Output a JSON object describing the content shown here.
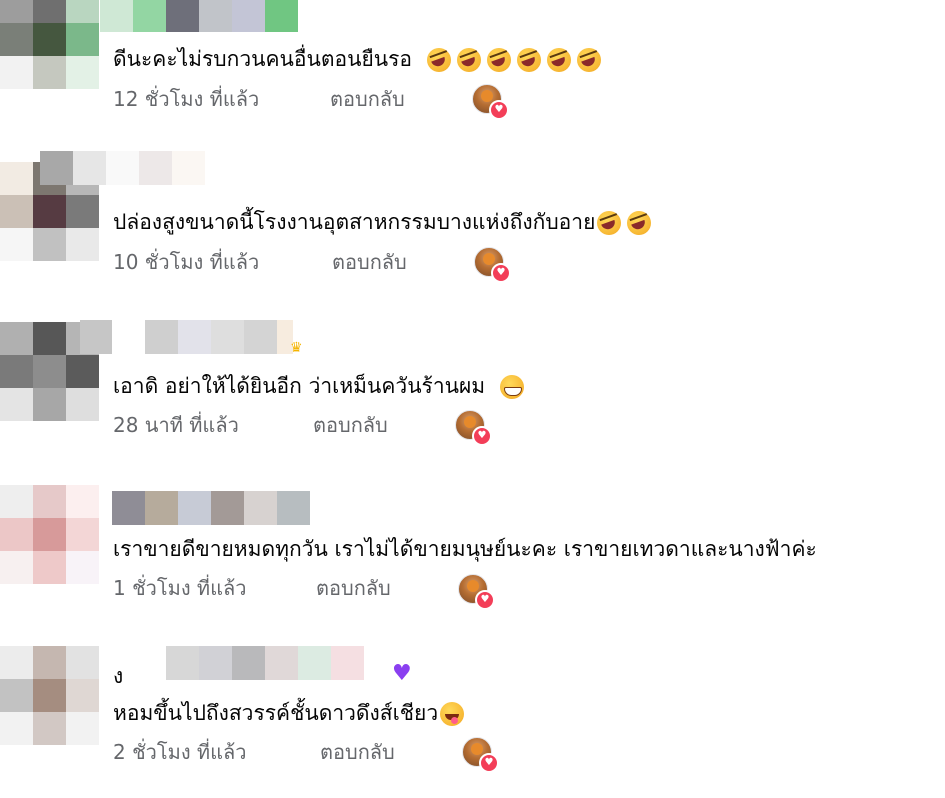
{
  "comments": [
    {
      "text": "ดีนะคะไม่รบกวนคนอื่นตอนยืนรอ",
      "emojis": [
        "rofl-icon",
        "rofl-icon",
        "rofl-icon",
        "rofl-icon",
        "rofl-icon",
        "rofl-icon"
      ],
      "time": "12 ชั่วโมง ที่แล้ว",
      "reply": "ตอบกลับ"
    },
    {
      "text": "ปล่องสูงขนาดนี้โรงงานอุตสาหกรรมบางแห่งถึงกับอาย",
      "emojis": [
        "rofl-icon",
        "rofl-icon"
      ],
      "time": "10 ชั่วโมง ที่แล้ว",
      "reply": "ตอบกลับ"
    },
    {
      "text": "เอาดิ อย่าให้ได้ยินอีก ว่าเหม็นควันร้านผม",
      "emojis": [
        "grin-icon"
      ],
      "time": "28 นาที ที่แล้ว",
      "reply": "ตอบกลับ"
    },
    {
      "text": "เราขายดีขายหมดทุกวัน เราไม่ได้ขายมนุษย์นะคะ เราขายเทวดาและนางฟ้าค่ะ",
      "emojis": [],
      "time": "1 ชั่วโมง ที่แล้ว",
      "reply": "ตอบกลับ"
    },
    {
      "name_prefix": "ง",
      "text": "หอมขึ้นไปถึงสวรรค์ชั้นดาวดึงส์เชียว",
      "emojis": [
        "tongue-icon"
      ],
      "time": "2 ชั่วโมง ที่แล้ว",
      "reply": "ตอบกลับ"
    }
  ],
  "icons": {
    "author_reaction": "love-icon",
    "name_badge": "crown-icon",
    "purple_heart": "purple-heart-icon"
  },
  "colors": {
    "text": "#050505",
    "meta": "#65676b",
    "love": "#f33e58",
    "purple_heart": "#8a3ff0"
  }
}
